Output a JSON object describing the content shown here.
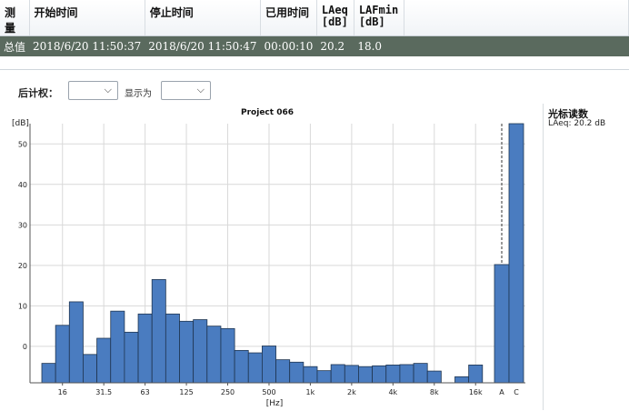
{
  "table": {
    "headers": {
      "measure": "测量",
      "start": "开始时间",
      "stop": "停止时间",
      "elapsed": "已用时间",
      "laeq": "LAeq",
      "laeq_unit": "[dB]",
      "lafmin": "LAFmin",
      "lafmin_unit": "[dB]"
    },
    "row": {
      "label": "总值",
      "start": "2018/6/20 11:50:37",
      "stop": "2018/6/20 11:50:47",
      "elapsed": "00:00:10",
      "laeq": "20.2",
      "lafmin": "18.0"
    }
  },
  "controls": {
    "post_weighting_label": "后计权：",
    "post_weighting_value": "",
    "display_as_label": "显示为",
    "display_as_value": ""
  },
  "cursor": {
    "title": "光标读数",
    "value": "LAeq: 20.2 dB"
  },
  "colors": {
    "bar": "#4a7cc0",
    "bar_stroke": "#1f3550",
    "grid": "#d9d9d9",
    "row_bg": "#5a6a5e"
  },
  "chart_data": {
    "type": "bar",
    "title": "Project 066",
    "xlabel": "[Hz]",
    "ylabel": "[dB]",
    "ylim": [
      -9,
      55
    ],
    "yticks": [
      0,
      10,
      20,
      30,
      40,
      50
    ],
    "grid": true,
    "categories": [
      "12.5",
      "16",
      "20",
      "25",
      "31.5",
      "40",
      "50",
      "63",
      "80",
      "100",
      "125",
      "160",
      "200",
      "250",
      "315",
      "400",
      "500",
      "630",
      "800",
      "1k",
      "1.25k",
      "1.6k",
      "2k",
      "2.5k",
      "3.15k",
      "4k",
      "5k",
      "6.3k",
      "8k",
      "10k",
      "12.5k",
      "16k",
      "20k"
    ],
    "values": [
      -4.2,
      5.2,
      11.0,
      -2.0,
      2.0,
      8.7,
      3.5,
      8.0,
      16.5,
      8.0,
      6.2,
      6.6,
      5.0,
      4.4,
      -1.0,
      -1.6,
      0.1,
      -3.3,
      -3.9,
      -5.0,
      -6.0,
      -4.5,
      -4.7,
      -5.0,
      -4.8,
      -4.6,
      -4.5,
      -4.2,
      -6.1,
      null,
      -7.5,
      -4.6,
      null
    ],
    "xtick_labels": [
      {
        "label": "16",
        "at": 1
      },
      {
        "label": "31.5",
        "at": 4
      },
      {
        "label": "63",
        "at": 7
      },
      {
        "label": "125",
        "at": 10
      },
      {
        "label": "250",
        "at": 13
      },
      {
        "label": "500",
        "at": 16
      },
      {
        "label": "1k",
        "at": 19
      },
      {
        "label": "2k",
        "at": 22
      },
      {
        "label": "4k",
        "at": 25
      },
      {
        "label": "8k",
        "at": 28
      },
      {
        "label": "16k",
        "at": 31
      }
    ],
    "summary_bars": {
      "categories": [
        "A",
        "C"
      ],
      "values": [
        20.2,
        55.0
      ]
    }
  }
}
